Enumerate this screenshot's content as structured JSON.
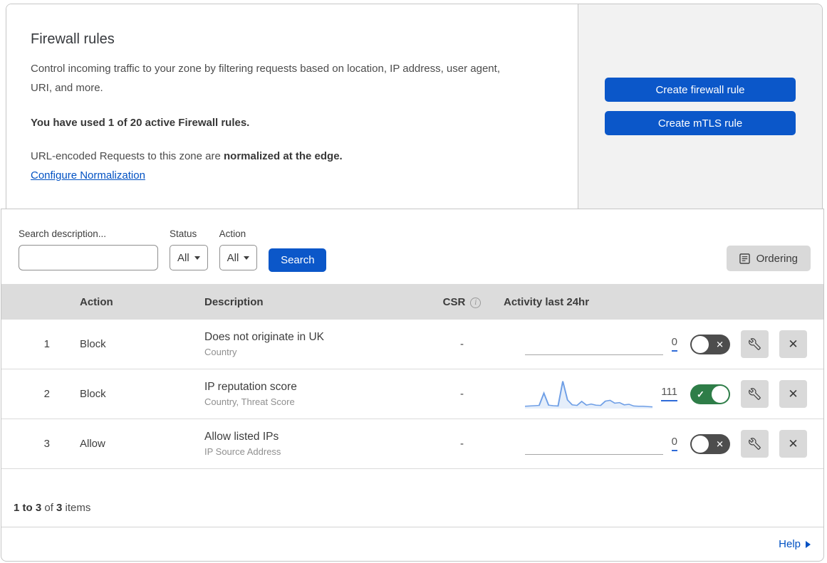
{
  "header": {
    "title": "Firewall rules",
    "description": "Control incoming traffic to your zone by filtering requests based on location, IP address, user agent, URI, and more.",
    "usage_note": "You have used 1 of 20 active Firewall rules.",
    "normalization_prefix": "URL-encoded Requests to this zone are ",
    "normalization_bold": "normalized at the edge.",
    "normalization_link": "Configure Normalization",
    "buttons": {
      "create_firewall": "Create firewall rule",
      "create_mtls": "Create mTLS rule"
    }
  },
  "filters": {
    "search_label": "Search description...",
    "search_value": "",
    "status_label": "Status",
    "status_value": "All",
    "action_label": "Action",
    "action_value": "All",
    "search_button": "Search",
    "ordering_button": "Ordering"
  },
  "table": {
    "columns": {
      "action": "Action",
      "description": "Description",
      "csr": "CSR",
      "activity": "Activity last 24hr"
    },
    "rows": [
      {
        "index": "1",
        "action": "Block",
        "description": "Does not originate in UK",
        "fields": "Country",
        "csr": "-",
        "activity_count": "0",
        "enabled": false
      },
      {
        "index": "2",
        "action": "Block",
        "description": "IP reputation score",
        "fields": "Country, Threat Score",
        "csr": "-",
        "activity_count": "111",
        "enabled": true,
        "sparkline_values": [
          8,
          9,
          10,
          11,
          54,
          12,
          10,
          9,
          96,
          30,
          13,
          11,
          25,
          12,
          16,
          12,
          11,
          26,
          29,
          19,
          21,
          13,
          15,
          9,
          8,
          8,
          7,
          6
        ]
      },
      {
        "index": "3",
        "action": "Allow",
        "description": "Allow listed IPs",
        "fields": "IP Source Address",
        "csr": "-",
        "activity_count": "0",
        "enabled": false
      }
    ]
  },
  "footer": {
    "range": "1 to 3",
    "of": " of ",
    "total": "3",
    "items": " items",
    "help_link": "Help"
  },
  "colors": {
    "accent_blue": "#0b57c9",
    "link_blue": "#0051c3",
    "toggle_on_green": "#2e7d48",
    "toggle_off_gray": "#4d4d4d",
    "sparkline_blue": "#6f9fe6",
    "table_header_gray": "#dcdcdc",
    "panel_gray": "#f2f2f2"
  }
}
